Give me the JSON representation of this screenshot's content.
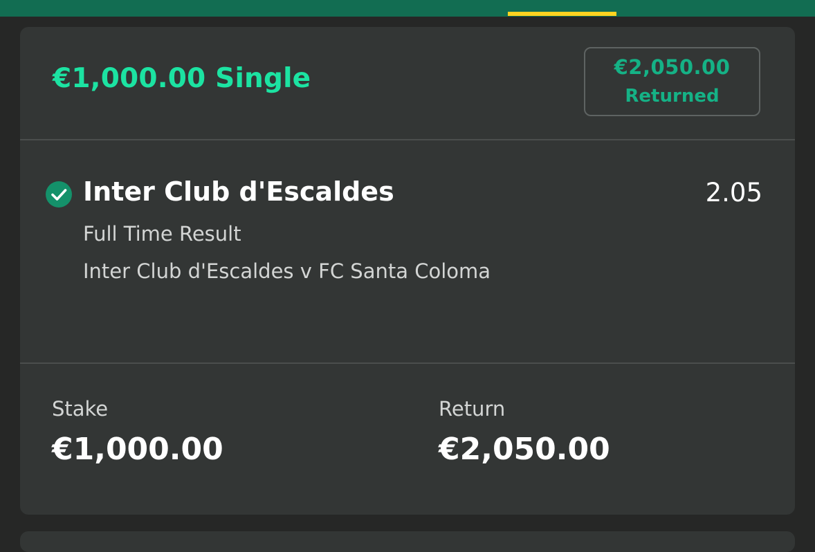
{
  "colors": {
    "top_bar": "#126d52",
    "tab_indicator": "#ffd321",
    "accent_green": "#1ce3a2",
    "returned_green": "#15b286",
    "check_green": "#14916a",
    "card_bg": "#333635",
    "page_bg": "#262726"
  },
  "bet": {
    "title": "€1,000.00 Single",
    "returned_amount": "€2,050.00",
    "returned_label": "Returned"
  },
  "selection": {
    "status_icon": "check-circle-icon",
    "name": "Inter Club d'Escaldes",
    "odds": "2.05",
    "market": "Full Time Result",
    "event": "Inter Club d'Escaldes v FC Santa Coloma"
  },
  "summary": {
    "stake_label": "Stake",
    "stake_value": "€1,000.00",
    "return_label": "Return",
    "return_value": "€2,050.00"
  }
}
